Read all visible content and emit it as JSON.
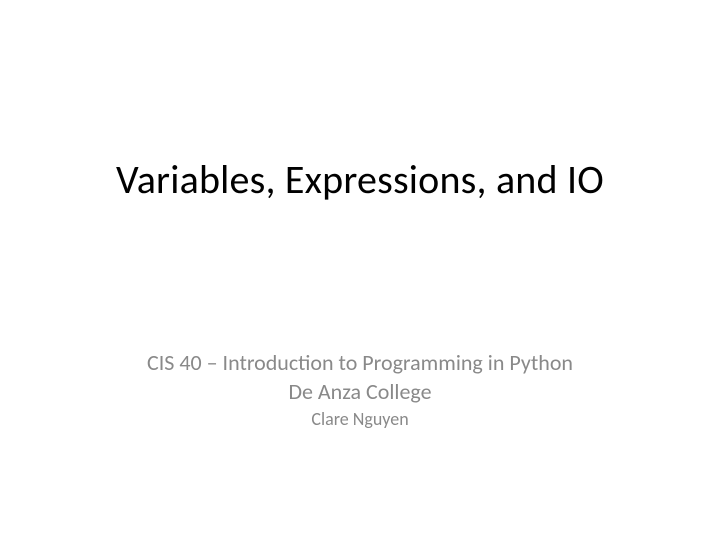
{
  "slide": {
    "title": "Variables, Expressions, and IO",
    "course": "CIS 40 – Introduction to Programming in Python",
    "college": "De Anza College",
    "author": "Clare Nguyen"
  }
}
